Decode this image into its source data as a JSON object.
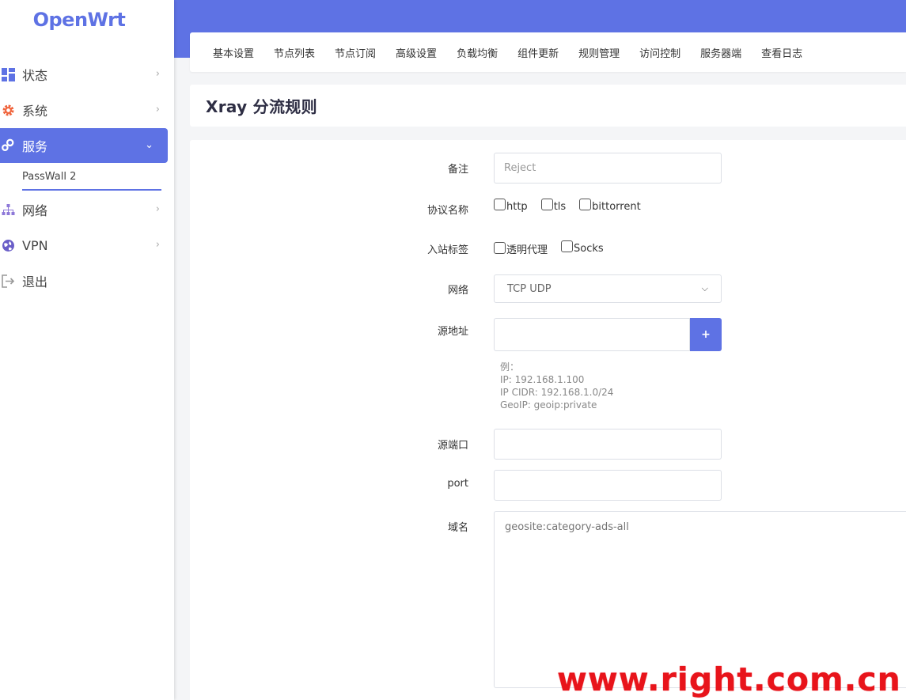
{
  "brand": "OpenWrt",
  "sidebar": {
    "items": [
      {
        "label": "状态",
        "icon": "dashboard-icon"
      },
      {
        "label": "系统",
        "icon": "gear-icon"
      },
      {
        "label": "服务",
        "icon": "gears-icon",
        "active": true
      },
      {
        "label": "网络",
        "icon": "network-icon"
      },
      {
        "label": "VPN",
        "icon": "globe-icon"
      },
      {
        "label": "退出",
        "icon": "logout-icon"
      }
    ],
    "sub_item": "PassWall 2"
  },
  "tabs": [
    "基本设置",
    "节点列表",
    "节点订阅",
    "高级设置",
    "负载均衡",
    "组件更新",
    "规则管理",
    "访问控制",
    "服务器端",
    "查看日志"
  ],
  "page_title": "Xray 分流规则",
  "form": {
    "remarks": {
      "label": "备注",
      "placeholder": "Reject"
    },
    "protocol": {
      "label": "协议名称",
      "options": [
        "http",
        "tls",
        "bittorrent"
      ]
    },
    "inbound": {
      "label": "入站标签",
      "options": [
        "透明代理",
        "Socks"
      ]
    },
    "network": {
      "label": "网络",
      "value": "TCP UDP"
    },
    "source": {
      "label": "源地址",
      "add": "+",
      "hint": [
        "例：",
        "IP: 192.168.1.100",
        "IP CIDR: 192.168.1.0/24",
        "GeoIP: geoip:private"
      ]
    },
    "source_port": {
      "label": "源端口"
    },
    "port": {
      "label": "port"
    },
    "domain": {
      "label": "域名",
      "placeholder": "geosite:category-ads-all"
    }
  },
  "watermark": "www.right.com.cn",
  "colors": {
    "accent": "#5e72e4",
    "watermark": "#e8141b"
  }
}
